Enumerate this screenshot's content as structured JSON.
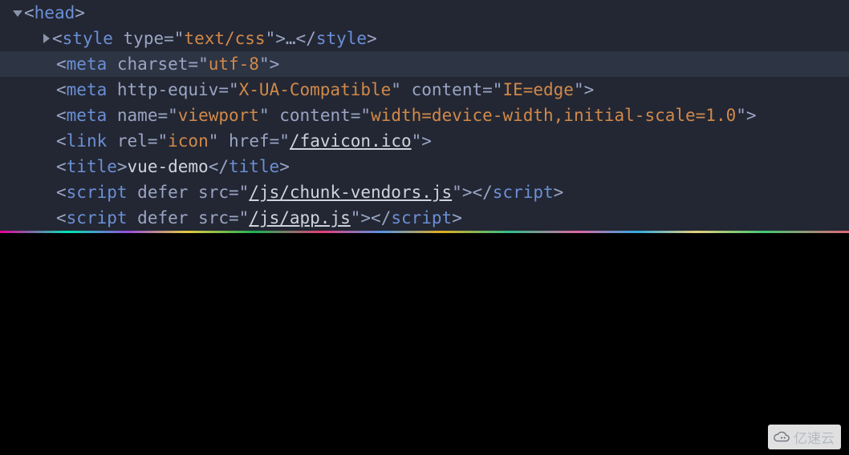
{
  "lines": [
    {
      "indent": 0,
      "arrow": "down",
      "parts": [
        {
          "t": "punct",
          "v": "<"
        },
        {
          "t": "tag",
          "v": "head"
        },
        {
          "t": "punct",
          "v": ">"
        }
      ]
    },
    {
      "indent": 2,
      "arrow": "right",
      "parts": [
        {
          "t": "punct",
          "v": "<"
        },
        {
          "t": "tag",
          "v": "style"
        },
        {
          "t": "punct",
          "v": " "
        },
        {
          "t": "attr-name",
          "v": "type"
        },
        {
          "t": "punct",
          "v": "="
        },
        {
          "t": "punct",
          "v": "\""
        },
        {
          "t": "attr-value",
          "v": "text/css"
        },
        {
          "t": "punct",
          "v": "\""
        },
        {
          "t": "punct",
          "v": ">"
        },
        {
          "t": "ellipsis",
          "v": "…"
        },
        {
          "t": "punct",
          "v": "</"
        },
        {
          "t": "tag",
          "v": "style"
        },
        {
          "t": "punct",
          "v": ">"
        }
      ]
    },
    {
      "indent": 2,
      "highlighted": true,
      "parts": [
        {
          "t": "punct",
          "v": "<"
        },
        {
          "t": "tag",
          "v": "meta"
        },
        {
          "t": "punct",
          "v": " "
        },
        {
          "t": "attr-name",
          "v": "charset"
        },
        {
          "t": "punct",
          "v": "="
        },
        {
          "t": "punct",
          "v": "\""
        },
        {
          "t": "attr-value",
          "v": "utf-8"
        },
        {
          "t": "punct",
          "v": "\""
        },
        {
          "t": "punct",
          "v": ">"
        }
      ]
    },
    {
      "indent": 2,
      "parts": [
        {
          "t": "punct",
          "v": "<"
        },
        {
          "t": "tag",
          "v": "meta"
        },
        {
          "t": "punct",
          "v": " "
        },
        {
          "t": "attr-name",
          "v": "http-equiv"
        },
        {
          "t": "punct",
          "v": "="
        },
        {
          "t": "punct",
          "v": "\""
        },
        {
          "t": "attr-value",
          "v": "X-UA-Compatible"
        },
        {
          "t": "punct",
          "v": "\""
        },
        {
          "t": "punct",
          "v": " "
        },
        {
          "t": "attr-name",
          "v": "content"
        },
        {
          "t": "punct",
          "v": "="
        },
        {
          "t": "punct",
          "v": "\""
        },
        {
          "t": "attr-value",
          "v": "IE=edge"
        },
        {
          "t": "punct",
          "v": "\""
        },
        {
          "t": "punct",
          "v": ">"
        }
      ]
    },
    {
      "indent": 2,
      "parts": [
        {
          "t": "punct",
          "v": "<"
        },
        {
          "t": "tag",
          "v": "meta"
        },
        {
          "t": "punct",
          "v": " "
        },
        {
          "t": "attr-name",
          "v": "name"
        },
        {
          "t": "punct",
          "v": "="
        },
        {
          "t": "punct",
          "v": "\""
        },
        {
          "t": "attr-value",
          "v": "viewport"
        },
        {
          "t": "punct",
          "v": "\""
        },
        {
          "t": "punct",
          "v": " "
        },
        {
          "t": "attr-name",
          "v": "content"
        },
        {
          "t": "punct",
          "v": "="
        },
        {
          "t": "punct",
          "v": "\""
        },
        {
          "t": "attr-value",
          "v": "width=device-width,initial-scale=1.0"
        },
        {
          "t": "punct",
          "v": "\""
        },
        {
          "t": "punct",
          "v": ">"
        }
      ]
    },
    {
      "indent": 2,
      "parts": [
        {
          "t": "punct",
          "v": "<"
        },
        {
          "t": "tag",
          "v": "link"
        },
        {
          "t": "punct",
          "v": " "
        },
        {
          "t": "attr-name",
          "v": "rel"
        },
        {
          "t": "punct",
          "v": "="
        },
        {
          "t": "punct",
          "v": "\""
        },
        {
          "t": "attr-value",
          "v": "icon"
        },
        {
          "t": "punct",
          "v": "\""
        },
        {
          "t": "punct",
          "v": " "
        },
        {
          "t": "attr-name",
          "v": "href"
        },
        {
          "t": "punct",
          "v": "="
        },
        {
          "t": "punct",
          "v": "\""
        },
        {
          "t": "link",
          "v": "/favicon.ico"
        },
        {
          "t": "punct",
          "v": "\""
        },
        {
          "t": "punct",
          "v": ">"
        }
      ]
    },
    {
      "indent": 2,
      "parts": [
        {
          "t": "punct",
          "v": "<"
        },
        {
          "t": "tag",
          "v": "title"
        },
        {
          "t": "punct",
          "v": ">"
        },
        {
          "t": "text-content",
          "v": "vue-demo"
        },
        {
          "t": "punct",
          "v": "</"
        },
        {
          "t": "tag",
          "v": "title"
        },
        {
          "t": "punct",
          "v": ">"
        }
      ]
    },
    {
      "indent": 2,
      "parts": [
        {
          "t": "punct",
          "v": "<"
        },
        {
          "t": "tag",
          "v": "script"
        },
        {
          "t": "punct",
          "v": " "
        },
        {
          "t": "attr-name",
          "v": "defer"
        },
        {
          "t": "punct",
          "v": " "
        },
        {
          "t": "attr-name",
          "v": "src"
        },
        {
          "t": "punct",
          "v": "="
        },
        {
          "t": "punct",
          "v": "\""
        },
        {
          "t": "link",
          "v": "/js/chunk-vendors.js"
        },
        {
          "t": "punct",
          "v": "\""
        },
        {
          "t": "punct",
          "v": ">"
        },
        {
          "t": "punct",
          "v": "</"
        },
        {
          "t": "tag",
          "v": "script"
        },
        {
          "t": "punct",
          "v": ">"
        }
      ]
    },
    {
      "indent": 2,
      "parts": [
        {
          "t": "punct",
          "v": "<"
        },
        {
          "t": "tag",
          "v": "script"
        },
        {
          "t": "punct",
          "v": " "
        },
        {
          "t": "attr-name",
          "v": "defer"
        },
        {
          "t": "punct",
          "v": " "
        },
        {
          "t": "attr-name",
          "v": "src"
        },
        {
          "t": "punct",
          "v": "="
        },
        {
          "t": "punct",
          "v": "\""
        },
        {
          "t": "link",
          "v": "/js/app.js"
        },
        {
          "t": "punct",
          "v": "\""
        },
        {
          "t": "punct",
          "v": ">"
        },
        {
          "t": "punct",
          "v": "</"
        },
        {
          "t": "tag",
          "v": "script"
        },
        {
          "t": "punct",
          "v": ">"
        }
      ]
    }
  ],
  "watermark": {
    "text": "亿速云"
  }
}
